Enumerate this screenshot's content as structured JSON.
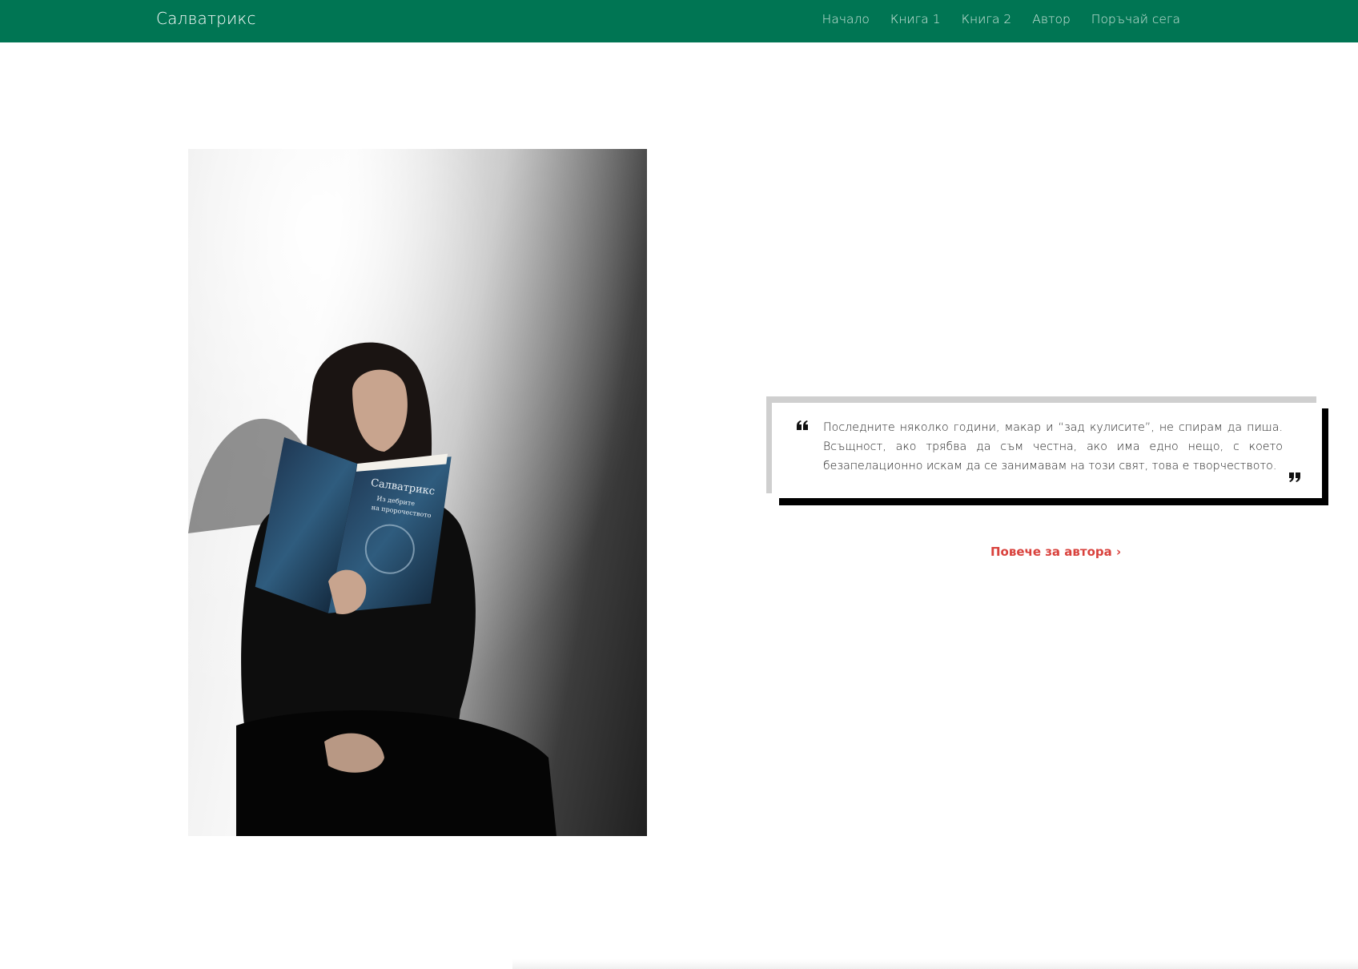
{
  "navbar": {
    "brand": "Салватрикс",
    "links": [
      "Начало",
      "Книга 1",
      "Книга 2",
      "Автор",
      "Поръчай сега"
    ],
    "background": "#007553"
  },
  "photo": {
    "book_cover_lines": [
      "Салватрикс",
      "Из дебрите",
      "на пророчеството"
    ]
  },
  "quote": {
    "text": "Последните няколко години, макар и “зад кулисите”, не спирам да пиша. Всъщност, ако трябва да съм честна, ако има едно нещо, с което безапелационно искам да се занимавам на този свят, това е творчеството.",
    "open_icon": "quote-open-icon",
    "close_icon": "quote-close-icon"
  },
  "more_link": {
    "label": "Повече за автора ›",
    "color": "#d9423d"
  }
}
